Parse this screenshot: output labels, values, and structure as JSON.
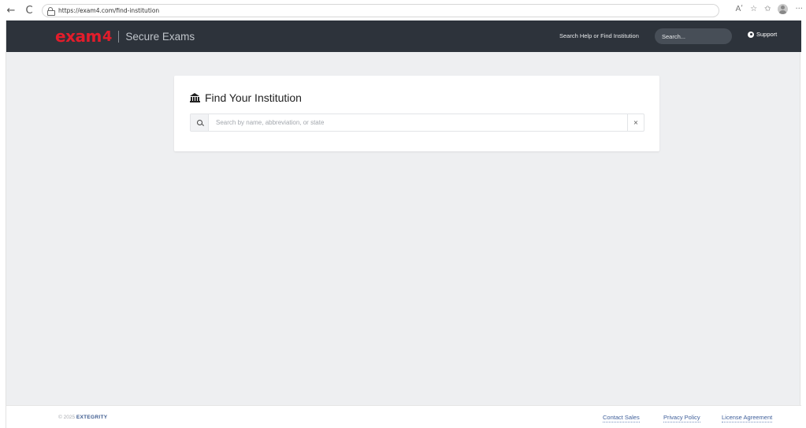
{
  "browser": {
    "url": "https://exam4.com/find-institution",
    "back_glyph": "←",
    "reload_glyph": "C",
    "read_aloud_glyph": "Aʹ",
    "favorite_glyph": "☆",
    "favorites_glyph": "✩",
    "more_glyph": "···"
  },
  "header": {
    "logo_exam": "exam",
    "logo_four": "4",
    "logo_subtitle": "Secure Exams",
    "search_label": "Search Help or Find Institution",
    "search_placeholder": "Search...",
    "support_label": "Support",
    "background_color": "#2d333b",
    "brand_color": "#e21d2b"
  },
  "card": {
    "title": "Find Your Institution",
    "search_placeholder": "Search by name, abbreviation, or state",
    "clear_glyph": "×"
  },
  "footer": {
    "copyright": "© 2025",
    "brand": "EXTEGRITY",
    "links": [
      "Contact Sales",
      "Privacy Policy",
      "License Agreement"
    ]
  }
}
